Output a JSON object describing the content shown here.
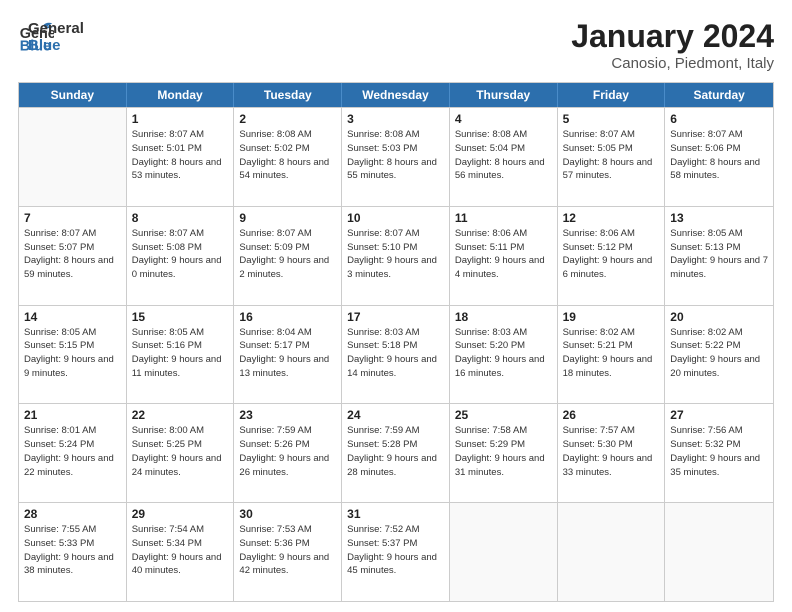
{
  "logo": {
    "general": "General",
    "blue": "Blue"
  },
  "title": "January 2024",
  "subtitle": "Canosio, Piedmont, Italy",
  "days_of_week": [
    "Sunday",
    "Monday",
    "Tuesday",
    "Wednesday",
    "Thursday",
    "Friday",
    "Saturday"
  ],
  "weeks": [
    [
      {
        "day": "",
        "info": ""
      },
      {
        "day": "1",
        "info": "Sunrise: 8:07 AM\nSunset: 5:01 PM\nDaylight: 8 hours\nand 53 minutes."
      },
      {
        "day": "2",
        "info": "Sunrise: 8:08 AM\nSunset: 5:02 PM\nDaylight: 8 hours\nand 54 minutes."
      },
      {
        "day": "3",
        "info": "Sunrise: 8:08 AM\nSunset: 5:03 PM\nDaylight: 8 hours\nand 55 minutes."
      },
      {
        "day": "4",
        "info": "Sunrise: 8:08 AM\nSunset: 5:04 PM\nDaylight: 8 hours\nand 56 minutes."
      },
      {
        "day": "5",
        "info": "Sunrise: 8:07 AM\nSunset: 5:05 PM\nDaylight: 8 hours\nand 57 minutes."
      },
      {
        "day": "6",
        "info": "Sunrise: 8:07 AM\nSunset: 5:06 PM\nDaylight: 8 hours\nand 58 minutes."
      }
    ],
    [
      {
        "day": "7",
        "info": "Sunrise: 8:07 AM\nSunset: 5:07 PM\nDaylight: 8 hours\nand 59 minutes."
      },
      {
        "day": "8",
        "info": "Sunrise: 8:07 AM\nSunset: 5:08 PM\nDaylight: 9 hours\nand 0 minutes."
      },
      {
        "day": "9",
        "info": "Sunrise: 8:07 AM\nSunset: 5:09 PM\nDaylight: 9 hours\nand 2 minutes."
      },
      {
        "day": "10",
        "info": "Sunrise: 8:07 AM\nSunset: 5:10 PM\nDaylight: 9 hours\nand 3 minutes."
      },
      {
        "day": "11",
        "info": "Sunrise: 8:06 AM\nSunset: 5:11 PM\nDaylight: 9 hours\nand 4 minutes."
      },
      {
        "day": "12",
        "info": "Sunrise: 8:06 AM\nSunset: 5:12 PM\nDaylight: 9 hours\nand 6 minutes."
      },
      {
        "day": "13",
        "info": "Sunrise: 8:05 AM\nSunset: 5:13 PM\nDaylight: 9 hours\nand 7 minutes."
      }
    ],
    [
      {
        "day": "14",
        "info": "Sunrise: 8:05 AM\nSunset: 5:15 PM\nDaylight: 9 hours\nand 9 minutes."
      },
      {
        "day": "15",
        "info": "Sunrise: 8:05 AM\nSunset: 5:16 PM\nDaylight: 9 hours\nand 11 minutes."
      },
      {
        "day": "16",
        "info": "Sunrise: 8:04 AM\nSunset: 5:17 PM\nDaylight: 9 hours\nand 13 minutes."
      },
      {
        "day": "17",
        "info": "Sunrise: 8:03 AM\nSunset: 5:18 PM\nDaylight: 9 hours\nand 14 minutes."
      },
      {
        "day": "18",
        "info": "Sunrise: 8:03 AM\nSunset: 5:20 PM\nDaylight: 9 hours\nand 16 minutes."
      },
      {
        "day": "19",
        "info": "Sunrise: 8:02 AM\nSunset: 5:21 PM\nDaylight: 9 hours\nand 18 minutes."
      },
      {
        "day": "20",
        "info": "Sunrise: 8:02 AM\nSunset: 5:22 PM\nDaylight: 9 hours\nand 20 minutes."
      }
    ],
    [
      {
        "day": "21",
        "info": "Sunrise: 8:01 AM\nSunset: 5:24 PM\nDaylight: 9 hours\nand 22 minutes."
      },
      {
        "day": "22",
        "info": "Sunrise: 8:00 AM\nSunset: 5:25 PM\nDaylight: 9 hours\nand 24 minutes."
      },
      {
        "day": "23",
        "info": "Sunrise: 7:59 AM\nSunset: 5:26 PM\nDaylight: 9 hours\nand 26 minutes."
      },
      {
        "day": "24",
        "info": "Sunrise: 7:59 AM\nSunset: 5:28 PM\nDaylight: 9 hours\nand 28 minutes."
      },
      {
        "day": "25",
        "info": "Sunrise: 7:58 AM\nSunset: 5:29 PM\nDaylight: 9 hours\nand 31 minutes."
      },
      {
        "day": "26",
        "info": "Sunrise: 7:57 AM\nSunset: 5:30 PM\nDaylight: 9 hours\nand 33 minutes."
      },
      {
        "day": "27",
        "info": "Sunrise: 7:56 AM\nSunset: 5:32 PM\nDaylight: 9 hours\nand 35 minutes."
      }
    ],
    [
      {
        "day": "28",
        "info": "Sunrise: 7:55 AM\nSunset: 5:33 PM\nDaylight: 9 hours\nand 38 minutes."
      },
      {
        "day": "29",
        "info": "Sunrise: 7:54 AM\nSunset: 5:34 PM\nDaylight: 9 hours\nand 40 minutes."
      },
      {
        "day": "30",
        "info": "Sunrise: 7:53 AM\nSunset: 5:36 PM\nDaylight: 9 hours\nand 42 minutes."
      },
      {
        "day": "31",
        "info": "Sunrise: 7:52 AM\nSunset: 5:37 PM\nDaylight: 9 hours\nand 45 minutes."
      },
      {
        "day": "",
        "info": ""
      },
      {
        "day": "",
        "info": ""
      },
      {
        "day": "",
        "info": ""
      }
    ]
  ]
}
